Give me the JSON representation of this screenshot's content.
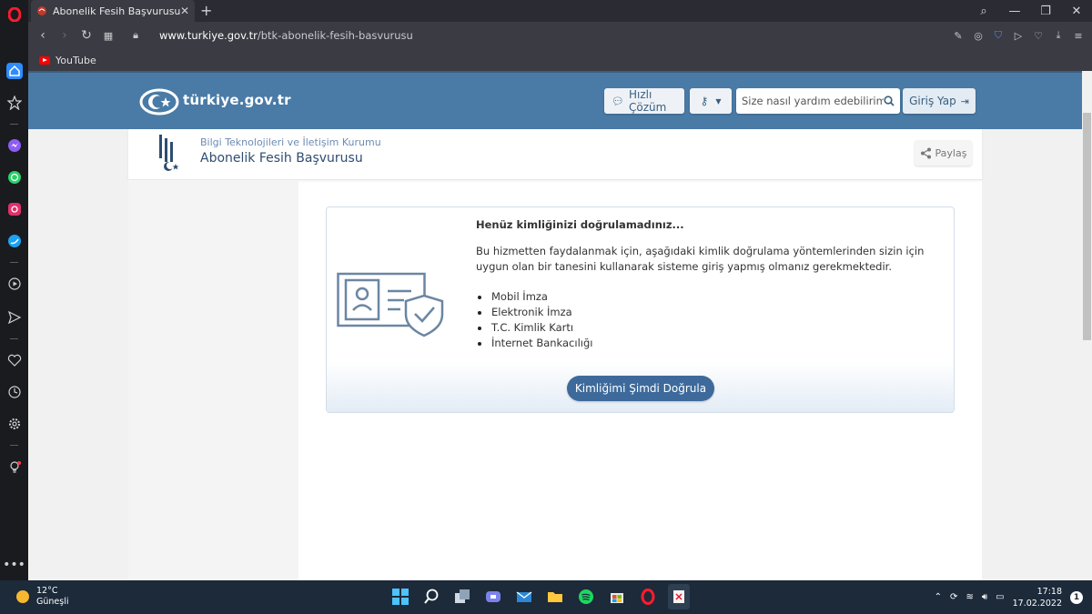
{
  "browser": {
    "tab_title": "Abonelik Fesih Başvurusu",
    "tab_close": "✕",
    "new_tab": "+",
    "url_domain": "www.turkiye.gov.tr",
    "url_path": "/btk-abonelik-fesih-basvurusu",
    "bookmark_youtube": "YouTube"
  },
  "site": {
    "logo_text": "türkiye.gov.tr",
    "quick_solution": "Hızlı Çözüm",
    "search_placeholder": "Size nasıl yardım edebilirim?",
    "login": "Giriş Yap"
  },
  "agency": {
    "name": "Bilgi Teknolojileri ve İletişim Kurumu",
    "service": "Abonelik Fesih Başvurusu",
    "share": "Paylaş"
  },
  "card": {
    "title": "Henüz kimliğinizi doğrulamadınız...",
    "description": "Bu hizmetten faydalanmak için, aşağıdaki kimlik doğrulama yöntemlerinden sizin için uygun olan bir tanesini kullanarak sisteme giriş yapmış olmanız gerekmektedir.",
    "methods": [
      "Mobil İmza",
      "Elektronik İmza",
      "T.C. Kimlik Kartı",
      "İnternet Bankacılığı"
    ],
    "button": "Kimliğimi Şimdi Doğrula"
  },
  "taskbar": {
    "temperature": "12°C",
    "weather": "Güneşli",
    "time": "17:18",
    "date": "17.02.2022",
    "notifications": "1"
  },
  "colors": {
    "header_blue": "#4a7ba6",
    "button_blue": "#3d6a9b",
    "taskbar": "#1c2a3a"
  }
}
